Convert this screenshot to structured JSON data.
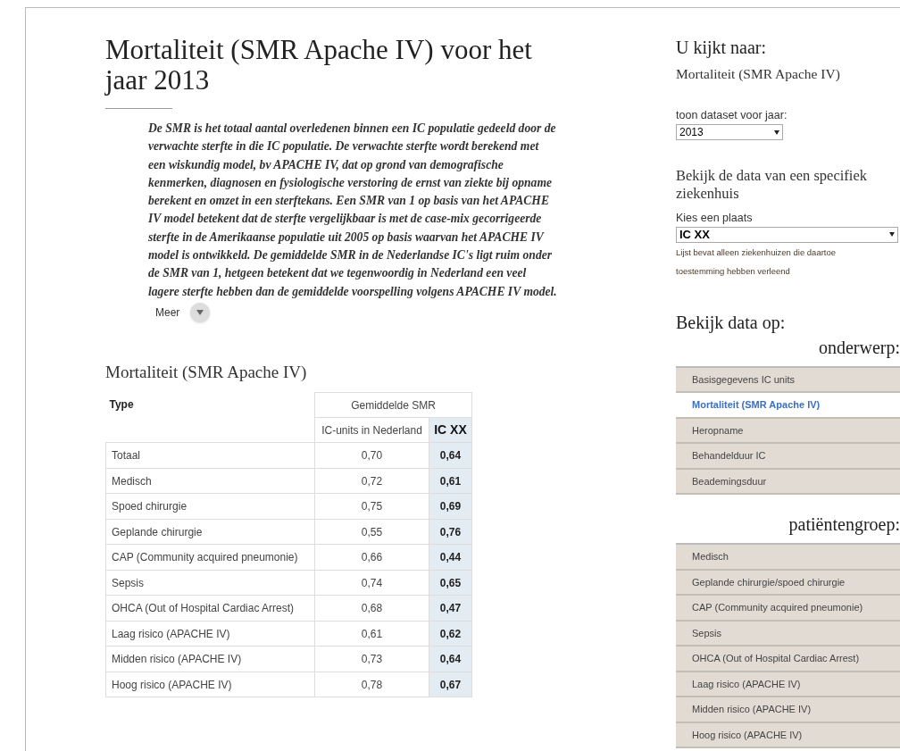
{
  "page_title": "Mortaliteit (SMR Apache IV) voor het jaar 2013",
  "intro": "De SMR is het totaal aantal overledenen binnen een IC populatie gedeeld door de verwachte sterfte in die IC populatie. De verwachte sterfte wordt berekend met een wiskundig model, bv APACHE IV, dat op grond van demografische kenmerken, diagnosen en fysiologische verstoring de ernst van ziekte bij opname berekent en omzet in een sterftekans. Een SMR van 1 op basis van het APACHE IV model betekent dat de sterfte vergelijkbaar is met de case-mix gecorrigeerde sterfte in de Amerikaanse populatie uit 2005 op basis waarvan het APACHE IV model is ontwikkeld. De gemiddelde SMR in de Nederlandse IC's ligt ruim onder de SMR van 1, hetgeen betekent dat we tegenwoordig in Nederland een veel lagere sterfte hebben dan de gemiddelde voorspelling volgens APACHE IV model.",
  "more_label": "Meer",
  "table": {
    "title": "Mortaliteit (SMR Apache IV)",
    "type_header": "Type",
    "group_header": "Gemiddelde SMR",
    "columns": [
      "IC-units in Nederland",
      "IC XX"
    ],
    "rows": [
      {
        "type": "Totaal",
        "nl": "0,70",
        "ic": "0,64"
      },
      {
        "type": "Medisch",
        "nl": "0,72",
        "ic": "0,61"
      },
      {
        "type": "Spoed chirurgie",
        "nl": "0,75",
        "ic": "0,69"
      },
      {
        "type": "Geplande chirurgie",
        "nl": "0,55",
        "ic": "0,76"
      },
      {
        "type": "CAP (Community acquired pneumonie)",
        "nl": "0,66",
        "ic": "0,44"
      },
      {
        "type": "Sepsis",
        "nl": "0,74",
        "ic": "0,65"
      },
      {
        "type": "OHCA (Out of Hospital Cardiac Arrest)",
        "nl": "0,68",
        "ic": "0,47"
      },
      {
        "type": "Laag risico (APACHE IV)",
        "nl": "0,61",
        "ic": "0,62"
      },
      {
        "type": "Midden risico (APACHE IV)",
        "nl": "0,73",
        "ic": "0,64"
      },
      {
        "type": "Hoog risico (APACHE IV)",
        "nl": "0,78",
        "ic": "0,67"
      }
    ]
  },
  "sidebar": {
    "viewing_heading": "U kijkt naar:",
    "viewing_value": "Mortaliteit (SMR Apache IV)",
    "year_label": "toon dataset voor jaar:",
    "year_value": "2013",
    "hospital_heading": "Bekijk de data van een specifiek ziekenhuis",
    "place_label": "Kies een plaats",
    "place_value": "IC XX",
    "place_note": "Lijst bevat alleen ziekenhuizen die daartoe toestemming hebben verleend",
    "view_heading": "Bekijk data op:",
    "menus": [
      {
        "heading": "onderwerp:",
        "items": [
          {
            "label": "Basisgegevens IC units",
            "selected": false
          },
          {
            "label": "Mortaliteit (SMR Apache IV)",
            "selected": true
          },
          {
            "label": "Heropname",
            "selected": false
          },
          {
            "label": "Behandelduur IC",
            "selected": false
          },
          {
            "label": "Beademingsduur",
            "selected": false
          }
        ]
      },
      {
        "heading": "patiëntengroep:",
        "items": [
          {
            "label": "Medisch",
            "selected": false
          },
          {
            "label": "Geplande chirurgie/spoed chirurgie",
            "selected": false
          },
          {
            "label": "CAP (Community acquired pneumonie)",
            "selected": false
          },
          {
            "label": "Sepsis",
            "selected": false
          },
          {
            "label": "OHCA (Out of Hospital Cardiac Arrest)",
            "selected": false
          },
          {
            "label": "Laag risico (APACHE IV)",
            "selected": false
          },
          {
            "label": "Midden risico (APACHE IV)",
            "selected": false
          },
          {
            "label": "Hoog risico (APACHE IV)",
            "selected": false
          }
        ]
      }
    ]
  }
}
